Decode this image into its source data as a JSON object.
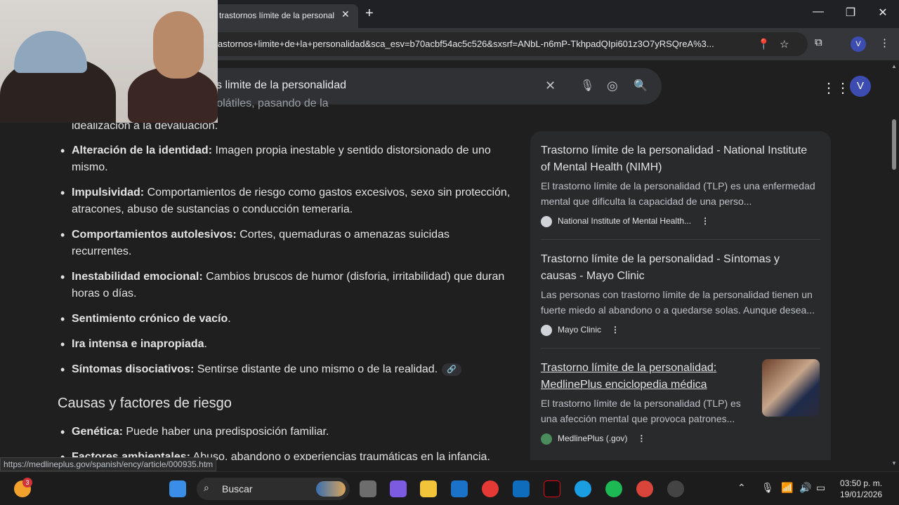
{
  "browser": {
    "tab_title": "trastornos límite de la personal",
    "tab_close": "✕",
    "new_tab": "+",
    "url": "astornos+limite+de+la+personalidad&sca_esv=b70acbf54ac5c526&sxsrf=ANbL-n6mP-TkhpadQIpi601z3O7yRSQreA%3...",
    "profile_initial": "V"
  },
  "search": {
    "query": "s limite de la personalidad",
    "user_initial": "V"
  },
  "content": {
    "fragment_line1": "ón de relaciones intensas y volátiles, pasando de la",
    "fragment_line2": "idealización a la devaluación.",
    "bullets": [
      {
        "term": "Alteración de la identidad:",
        "text": " Imagen propia inestable y sentido distorsionado de uno mismo."
      },
      {
        "term": "Impulsividad:",
        "text": " Comportamientos de riesgo como gastos excesivos, sexo sin protección, atracones, abuso de sustancias o conducción temeraria."
      },
      {
        "term": "Comportamientos autolesivos:",
        "text": " Cortes, quemaduras o amenazas suicidas recurrentes."
      },
      {
        "term": "Inestabilidad emocional:",
        "text": " Cambios bruscos de humor (disforia, irritabilidad) que duran horas o días."
      },
      {
        "term": "Sentimiento crónico de vacío",
        "text": "."
      },
      {
        "term": "Ira intensa e inapropiada",
        "text": "."
      },
      {
        "term": "Síntomas disociativos:",
        "text": " Sentirse distante de uno mismo o de la realidad."
      }
    ],
    "causes_heading": "Causas y factores de riesgo",
    "causes": [
      {
        "term": "Genética:",
        "text": " Puede haber una predisposición familiar."
      },
      {
        "term": "Factores ambientales:",
        "text": " Abuso, abandono o experiencias traumáticas en la infancia."
      }
    ]
  },
  "sources": [
    {
      "title": "Trastorno límite de la personalidad - National Institute of Mental Health (NIMH)",
      "snippet": "El trastorno límite de la personalidad (TLP) es una enfermedad mental que dificulta la capacidad de una perso...",
      "site": "National Institute of Mental Health..."
    },
    {
      "title": "Trastorno límite de la personalidad - Síntomas y causas - Mayo Clinic",
      "snippet": "Las personas con trastorno límite de la personalidad tienen un fuerte miedo al abandono o a quedarse solas. Aunque desea...",
      "site": "Mayo Clinic"
    },
    {
      "title": "Trastorno límite de la personalidad: MedlinePlus enciclopedia médica",
      "snippet": "El trastorno límite de la personalidad (TLP) es una afección mental que provoca patrones...",
      "site": "MedlinePlus (.gov)"
    }
  ],
  "status_url": "https://medlineplus.gov/spanish/ency/article/000935.htm",
  "taskbar": {
    "search_label": "Buscar",
    "notification_count": "3",
    "time": "03:50 p. m.",
    "date": "19/01/2026"
  },
  "icons": {
    "close": "✕",
    "mic": "🎤",
    "lens": "◎",
    "search": "🔍",
    "apps": "⋮⋮⋮",
    "link": "🔗",
    "kebab": "⋮"
  },
  "colors": {
    "page_bg": "#1f1f1f",
    "panel_bg": "#282a2c",
    "accent_avatar": "#3c4cb0"
  }
}
